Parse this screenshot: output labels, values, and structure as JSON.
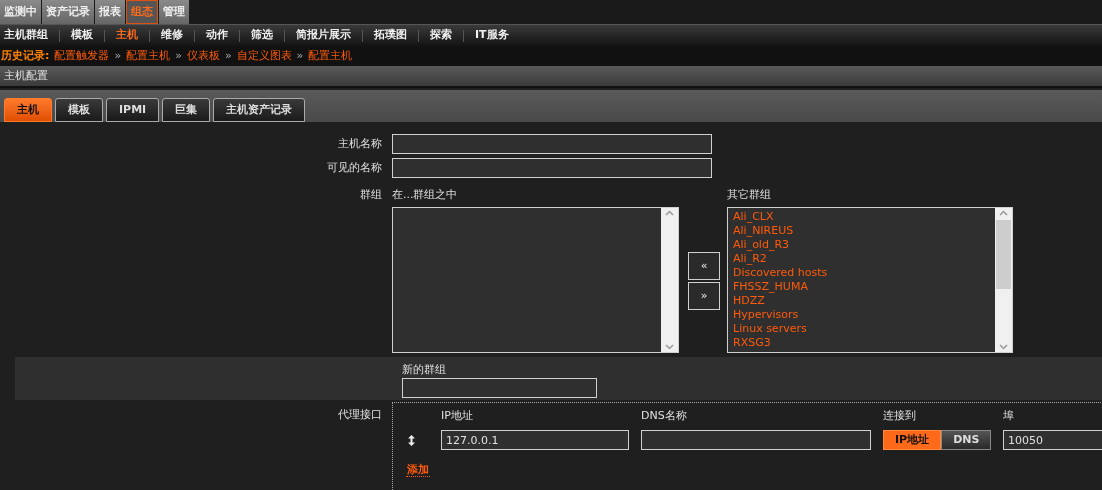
{
  "top_menu": [
    {
      "label": "监测中",
      "selected": false
    },
    {
      "label": "资产记录",
      "selected": false
    },
    {
      "label": "报表",
      "selected": false
    },
    {
      "label": "组态",
      "selected": true
    },
    {
      "label": "管理",
      "selected": false
    }
  ],
  "sub_menu": [
    {
      "label": "主机群组",
      "selected": false
    },
    {
      "label": "模板",
      "selected": false
    },
    {
      "label": "主机",
      "selected": true
    },
    {
      "label": "维修",
      "selected": false
    },
    {
      "label": "动作",
      "selected": false
    },
    {
      "label": "筛选",
      "selected": false
    },
    {
      "label": "简报片展示",
      "selected": false
    },
    {
      "label": "拓璞图",
      "selected": false
    },
    {
      "label": "探索",
      "selected": false
    },
    {
      "label": "IT服务",
      "selected": false
    }
  ],
  "history": {
    "label": "历史记录:",
    "separator": "»",
    "links": [
      "配置触发器",
      "配置主机",
      "仪表板",
      "自定义图表",
      "配置主机"
    ]
  },
  "section_title": "主机配置",
  "tabs": [
    {
      "label": "主机",
      "selected": true
    },
    {
      "label": "模板",
      "selected": false
    },
    {
      "label": "IPMI",
      "selected": false
    },
    {
      "label": "巨集",
      "selected": false
    },
    {
      "label": "主机资产记录",
      "selected": false
    }
  ],
  "form": {
    "host_name": {
      "label": "主机名称"
    },
    "visible_name": {
      "label": "可见的名称"
    },
    "groups": {
      "label": "群组",
      "in_groups_title": "在...群组之中",
      "other_groups_title": "其它群组",
      "add_button": "«",
      "remove_button": "»",
      "other_groups": [
        "Ali_CLX",
        "Ali_NIREUS",
        "Ali_old_R3",
        "Ali_R2",
        "Discovered hosts",
        "FHSSZ_HUMA",
        "HDZZ",
        "Hypervisors",
        "Linux servers",
        "RXSG3"
      ]
    },
    "new_group": {
      "label": "新的群组"
    },
    "agent_interfaces": {
      "label": "代理接口",
      "columns": [
        "IP地址",
        "DNS名称",
        "连接到",
        "埠"
      ],
      "rows": [
        {
          "ip": "127.0.0.1",
          "connect": [
            {
              "label": "IP地址",
              "selected": true
            },
            {
              "label": "DNS",
              "selected": false
            }
          ],
          "port": "10050"
        }
      ],
      "add_link": "添加"
    }
  }
}
